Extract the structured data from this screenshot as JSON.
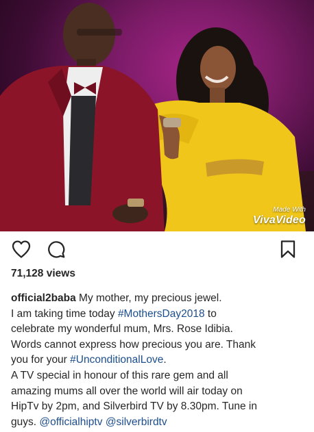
{
  "media": {
    "watermark_small": "Made With",
    "watermark_brand": "VivaVideo"
  },
  "actions": {
    "like_icon": "heart-outline-icon",
    "comment_icon": "speech-bubble-icon",
    "save_icon": "bookmark-icon"
  },
  "stats": {
    "views": "71,128 views"
  },
  "caption": {
    "username": "official2baba",
    "line1_text": " My mother, my precious jewel.",
    "line2_text": "I am taking time today ",
    "hashtag1": "#MothersDay2018",
    "line2_after": " to",
    "line3_text": "celebrate my wonderful mum, Mrs. Rose Idibia.",
    "line4_text": "Words cannot express how precious you are. Thank",
    "line5_text": "you for your ",
    "hashtag2": "#UnconditionalLove",
    "line5_after": ".",
    "line6_text": "A TV special in honour of this rare gem and all",
    "line7_text": "amazing mums all over the world will air today on",
    "line8_text": "HipTv by 2pm, and Silverbird TV by 8.30pm. Tune in",
    "line9_text": "guys. ",
    "mention1": "@officialhiptv",
    "mention_sep": " ",
    "mention2": "@silverbirdtv"
  },
  "colors": {
    "link": "#1c4e8e",
    "text": "#262626",
    "background": "#ffffff"
  }
}
